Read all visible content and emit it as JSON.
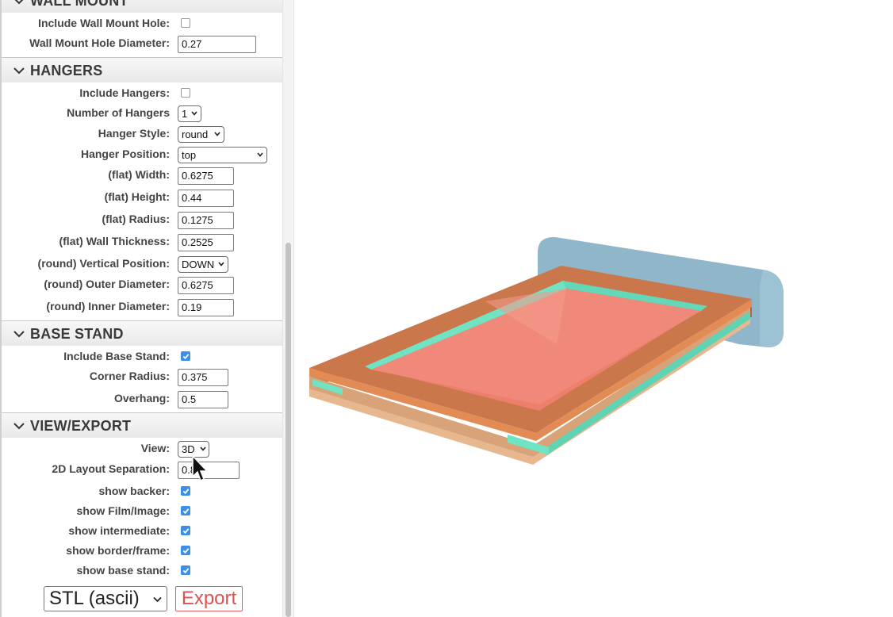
{
  "sections": {
    "wall_mount": {
      "title": "WALL MOUNT"
    },
    "hangers": {
      "title": "HANGERS"
    },
    "base_stand": {
      "title": "BASE STAND"
    },
    "view_export": {
      "title": "VIEW/EXPORT"
    }
  },
  "fields": {
    "include_wall_mount_hole": {
      "label": "Include Wall Mount Hole:",
      "checked": false
    },
    "wall_mount_hole_diameter": {
      "label": "Wall Mount Hole Diameter:",
      "value": "0.27"
    },
    "include_hangers": {
      "label": "Include Hangers:",
      "checked": false
    },
    "number_of_hangers": {
      "label": "Number of Hangers",
      "value": "1"
    },
    "hanger_style": {
      "label": "Hanger Style:",
      "value": "round"
    },
    "hanger_position": {
      "label": "Hanger Position:",
      "value": "top"
    },
    "flat_width": {
      "label": "(flat) Width:",
      "value": "0.6275"
    },
    "flat_height": {
      "label": "(flat) Height:",
      "value": "0.44"
    },
    "flat_radius": {
      "label": "(flat) Radius:",
      "value": "0.1275"
    },
    "flat_wall_thickness": {
      "label": "(flat) Wall Thickness:",
      "value": "0.2525"
    },
    "round_vertical_position": {
      "label": "(round) Vertical Position:",
      "value": "DOWN"
    },
    "round_outer_diameter": {
      "label": "(round) Outer Diameter:",
      "value": "0.6275"
    },
    "round_inner_diameter": {
      "label": "(round) Inner Diameter:",
      "value": "0.19"
    },
    "include_base_stand": {
      "label": "Include Base Stand:",
      "checked": true
    },
    "corner_radius": {
      "label": "Corner Radius:",
      "value": "0.375"
    },
    "overhang": {
      "label": "Overhang:",
      "value": "0.5"
    },
    "view": {
      "label": "View:",
      "value": "3D"
    },
    "layout_separation": {
      "label": "2D Layout Separation:",
      "value": "0.8"
    },
    "show_backer": {
      "label": "show backer:",
      "checked": true
    },
    "show_film_image": {
      "label": "show Film/Image:",
      "checked": true
    },
    "show_intermediate": {
      "label": "show intermediate:",
      "checked": true
    },
    "show_border_frame": {
      "label": "show border/frame:",
      "checked": true
    },
    "show_base_stand": {
      "label": "show base stand:",
      "checked": true
    }
  },
  "export": {
    "format": "STL (ascii)",
    "button_label": "Export"
  },
  "colors": {
    "accent_checkbox": "#3d8fe6",
    "export_red": "#e05050",
    "frame_copper": "#c9774b",
    "film_teal": "#6fe3c2",
    "image_salmon": "#ee7f6c",
    "backer_blue": "#8fb6c9",
    "base_tan": "#e0a97e"
  },
  "icons": {
    "section_toggle": "chevron-down-icon",
    "pointer": "mouse-cursor-icon"
  }
}
